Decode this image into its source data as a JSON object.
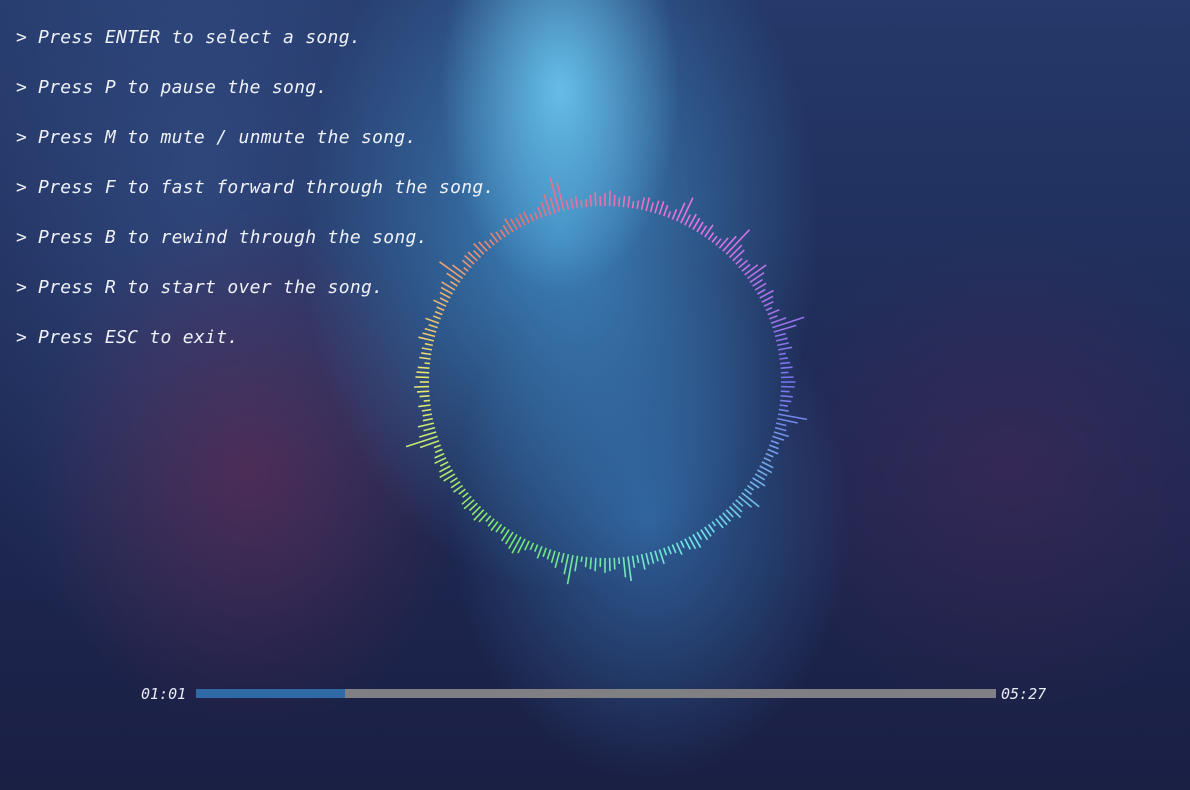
{
  "instructions": [
    {
      "prompt": ">",
      "text": "Press ENTER to select a song."
    },
    {
      "prompt": ">",
      "text": "Press P to pause the song."
    },
    {
      "prompt": ">",
      "text": "Press M to mute / unmute the song."
    },
    {
      "prompt": ">",
      "text": "Press F to fast forward through the song."
    },
    {
      "prompt": ">",
      "text": "Press B to rewind through the song."
    },
    {
      "prompt": ">",
      "text": "Press R to start over the song."
    },
    {
      "prompt": ">",
      "text": "Press ESC to exit."
    }
  ],
  "player": {
    "current_time": "01:01",
    "total_time": "05:27",
    "progress_fraction": 0.186,
    "progress_color": "#2f6aa6",
    "track_color": "#7f7f84"
  },
  "visualizer": {
    "type": "circular-spectrum",
    "color_scheme": "rainbow-hue-around-circle"
  }
}
